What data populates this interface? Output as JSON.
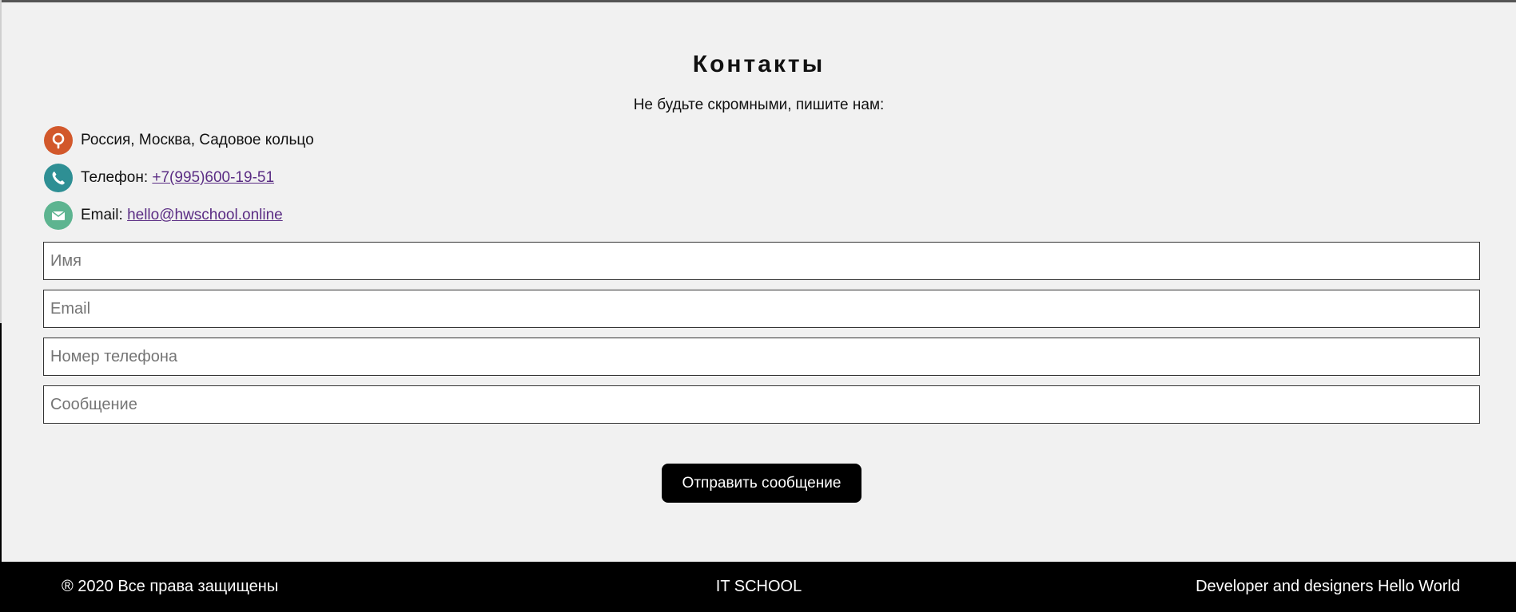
{
  "contacts": {
    "title": "Контакты",
    "subtitle": "Не будьте скромными, пишите нам:",
    "address": {
      "icon": "location-pin-icon",
      "color": "#d2582b",
      "text": "Россия, Москва, Садовое кольцо"
    },
    "phone": {
      "icon": "phone-icon",
      "color": "#2e8f94",
      "label": "Телефон: ",
      "value": "+7(995)600-19-51"
    },
    "email": {
      "icon": "mail-icon",
      "color": "#5db490",
      "label": "Email: ",
      "value": "hello@hwschool.online"
    }
  },
  "form": {
    "name_placeholder": "Имя",
    "email_placeholder": "Email",
    "phone_placeholder": "Номер телефона",
    "message_placeholder": "Сообщение",
    "submit_label": "Отправить сообщение"
  },
  "footer": {
    "copyright": "® 2020 Все права защищены",
    "brand": "IT SCHOOL",
    "credits": "Developer and designers Hello World"
  }
}
